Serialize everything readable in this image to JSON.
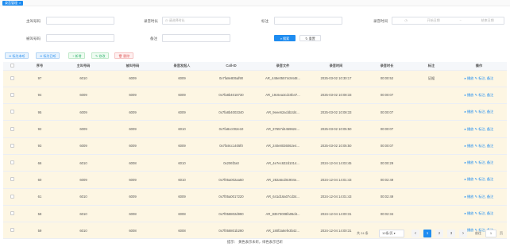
{
  "tab": {
    "label": "录音管理",
    "close": "×"
  },
  "form": {
    "caller_label": "主叫号码",
    "duration_label": "录音时长",
    "duration_placeholder": "请选择时长",
    "remark_label": "标注",
    "time_label": "录音时间",
    "start_placeholder": "开始日期",
    "range_sep": "~",
    "end_placeholder": "结束日期",
    "callee_label": "被叫号码",
    "note_label": "备注",
    "search_button": "搜索",
    "reset_button": "重置"
  },
  "actions": [
    "标为未听",
    "标为已听",
    "新增",
    "修改",
    "删除"
  ],
  "table": {
    "headers": [
      "",
      "序号",
      "主叫号码",
      "被叫号码",
      "录音发起人",
      "Call-ID",
      "录音文件",
      "录音时间",
      "录音时长",
      "标注",
      "操作"
    ],
    "rows": [
      {
        "no": "97",
        "caller": "6010",
        "callee": "6009",
        "initiator": "6009",
        "callid": "0x7fa8e805af90",
        "file": "AR_448e05574c9448...",
        "time": "2025-03-02 10:30:17",
        "duration": "00:00:52",
        "remark": "证据",
        "color": "yellow"
      },
      {
        "no": "94",
        "caller": "6009",
        "callee": "6009",
        "initiator": "6009",
        "callid": "0x7fa8b4018730",
        "file": "AR_19c6ea3cdc0b47...",
        "time": "2025-03-02 10:08:33",
        "duration": "00:00:07",
        "remark": "",
        "color": "yellow"
      },
      {
        "no": "95",
        "caller": "6009",
        "callee": "6009",
        "initiator": "6009",
        "callid": "0x7fa8b4003340",
        "file": "AR_9eee62acbb2d4...",
        "time": "2025-03-02 10:08:33",
        "duration": "00:00:07",
        "remark": "",
        "color": "yellow"
      },
      {
        "no": "92",
        "caller": "6009",
        "callee": "6009",
        "initiator": "6010",
        "callid": "0x7fa8cc002e10",
        "file": "AR_37657d4459624...",
        "time": "2025-03-02 10:05:50",
        "duration": "00:00:07",
        "remark": "",
        "color": "yellow"
      },
      {
        "no": "93",
        "caller": "6009",
        "callee": "6009",
        "initiator": "6009",
        "callid": "0x7fa9cc1405f0",
        "file": "AR_240e8036062e4...",
        "time": "2025-03-02 10:05:50",
        "duration": "00:00:07",
        "remark": "",
        "color": "yellow"
      },
      {
        "no": "66",
        "caller": "6010",
        "callee": "6008",
        "initiator": "6010",
        "callid": "0x206f2a0",
        "file": "AR_4e7ec632d1014...",
        "time": "2024-12-04 14:03:45",
        "duration": "00:00:29",
        "remark": "",
        "color": "yellow"
      },
      {
        "no": "60",
        "caller": "6009",
        "callee": "6009",
        "initiator": "6010",
        "callid": "0x7f05a002aa50",
        "file": "AR_282a6cd8c904e...",
        "time": "2024-12-04 14:01:43",
        "duration": "00:02:49",
        "remark": "",
        "color": "yellow"
      },
      {
        "no": "61",
        "caller": "6010",
        "callee": "6009",
        "initiator": "6009",
        "callid": "0x7f05a0017220",
        "file": "AR_641d16a07cd34...",
        "time": "2024-12-04 14:01:43",
        "duration": "00:02:49",
        "remark": "",
        "color": "yellow"
      },
      {
        "no": "58",
        "caller": "6010",
        "callee": "6008",
        "initiator": "6008",
        "callid": "0x7f058802d990",
        "file": "AR_83573008fa06d4...",
        "time": "2024-12-04 14:00:31",
        "duration": "00:02:34",
        "remark": "",
        "color": "yellow"
      },
      {
        "no": "59",
        "caller": "6010",
        "callee": "6008",
        "initiator": "6008",
        "callid": "0x7f058801b290",
        "file": "AR_180f2a8efe3b42...",
        "time": "2024-12-04 14:00:31",
        "duration": "00:02:34",
        "remark": "",
        "color": "yellow"
      }
    ],
    "op_listen": "播放",
    "op_mark": "标注",
    "op_note": "备注"
  },
  "pager": {
    "total": "共 24 条",
    "page_size": "10条/页",
    "pages": [
      "1",
      "2",
      "3"
    ],
    "goto_label": "前往",
    "goto_value": "1",
    "page_unit": "页",
    "prev": "<",
    "next": ">"
  },
  "hint": "提示： 黄色表示未听，绿色表示已听"
}
